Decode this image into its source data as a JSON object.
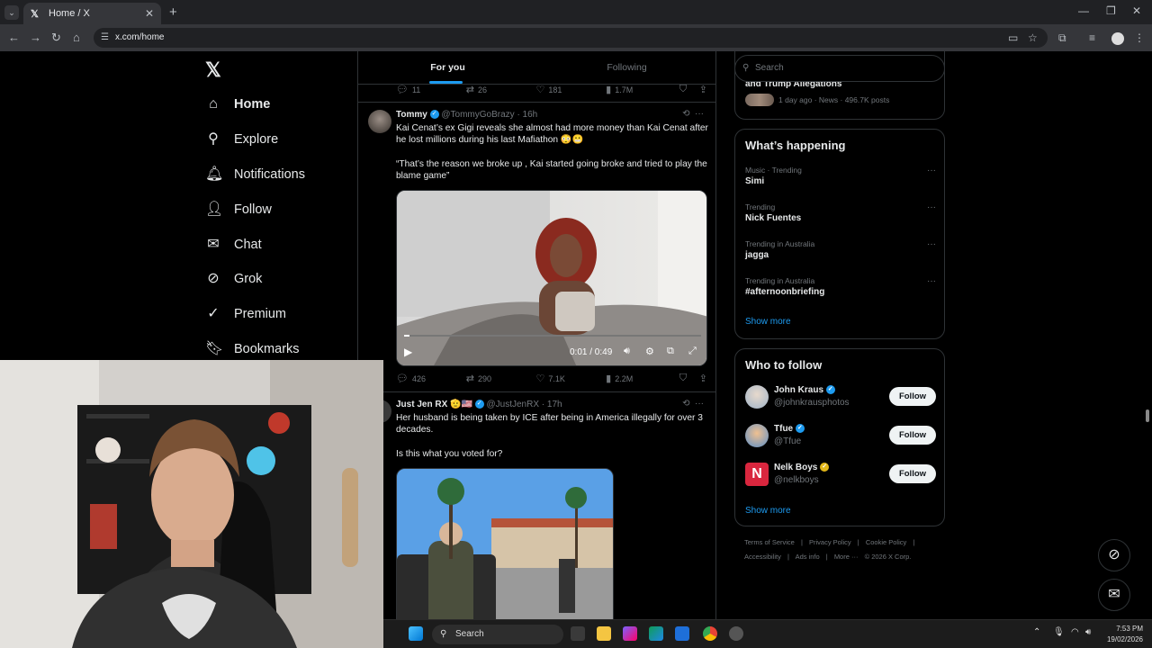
{
  "browser": {
    "tab_title": "Home / X",
    "url": "x.com/home"
  },
  "nav": {
    "items": [
      {
        "label": "Home",
        "icon": "home-icon"
      },
      {
        "label": "Explore",
        "icon": "search-icon"
      },
      {
        "label": "Notifications",
        "icon": "bell-icon"
      },
      {
        "label": "Follow",
        "icon": "add-user-icon"
      },
      {
        "label": "Chat",
        "icon": "mail-icon"
      },
      {
        "label": "Grok",
        "icon": "grok-icon"
      },
      {
        "label": "Premium",
        "icon": "premium-icon"
      },
      {
        "label": "Bookmarks",
        "icon": "bookmark-icon"
      }
    ]
  },
  "feed": {
    "tabs": [
      "For you",
      "Following"
    ],
    "top_actions": {
      "replies": "11",
      "reposts": "26",
      "likes": "181",
      "views": "1.7M"
    },
    "tweets": [
      {
        "name": "Tommy",
        "handle": "@TommyGoBrazy",
        "time": "· 16h",
        "text1": "Kai Cenat’s ex Gigi reveals she almost had more money than Kai Cenat after he lost millions during his last Mafiathon 😳😬",
        "text2": "“That’s the reason we broke up , Kai started going broke and tried to play the blame game”",
        "video_time": "0:01 / 0:49",
        "actions": {
          "replies": "426",
          "reposts": "290",
          "likes": "7.1K",
          "views": "2.2M"
        }
      },
      {
        "name": "Just Jen RX 🫡🇺🇸",
        "handle": "@JustJenRX",
        "time": "· 17h",
        "text1": "Her husband is being taken by ICE after being in America illegally for over 3 decades.",
        "text2": "Is this what you voted for?"
      }
    ]
  },
  "right": {
    "search_placeholder": "Search",
    "top_card": {
      "title": "and Trump Allegations",
      "meta": "1 day ago · News · 496.7K posts"
    },
    "happening": {
      "title": "What’s happening",
      "trends": [
        {
          "category": "Music · Trending",
          "title": "Simi"
        },
        {
          "category": "Trending",
          "title": "Nick Fuentes"
        },
        {
          "category": "Trending in Australia",
          "title": "jagga"
        },
        {
          "category": "Trending in Australia",
          "title": "#afternoonbriefing"
        }
      ],
      "show_more": "Show more"
    },
    "who_to_follow": {
      "title": "Who to follow",
      "users": [
        {
          "name": "John Kraus",
          "handle": "@johnkrausphotos",
          "button": "Follow"
        },
        {
          "name": "Tfue",
          "handle": "@Tfue",
          "button": "Follow"
        },
        {
          "name": "Nelk Boys",
          "handle": "@nelkboys",
          "button": "Follow"
        }
      ],
      "show_more": "Show more"
    },
    "footer": {
      "links": [
        "Terms of Service",
        "|",
        "Privacy Policy",
        "|",
        "Cookie Policy",
        "|"
      ],
      "links2": [
        "Accessibility",
        "|",
        "Ads info",
        "|",
        "More ···",
        "© 2026 X Corp."
      ]
    }
  },
  "taskbar": {
    "search": "Search",
    "time": "7:53 PM",
    "date": "19/02/2026"
  },
  "colors": {
    "accent": "#1d9bf0",
    "background": "#000000",
    "border": "#2f3336"
  }
}
